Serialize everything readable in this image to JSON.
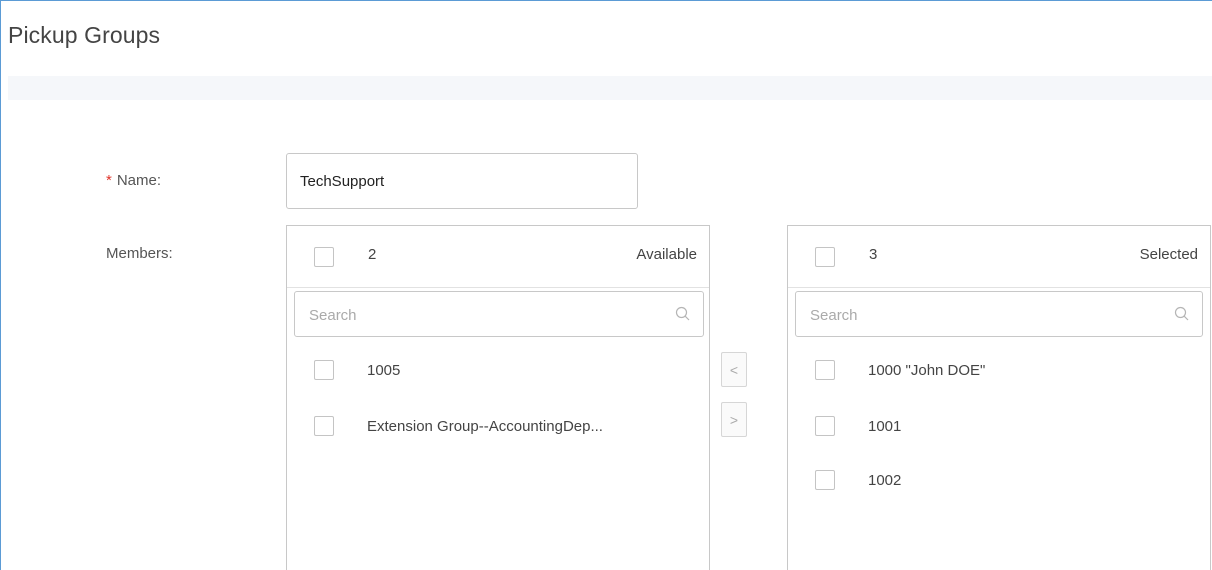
{
  "page": {
    "title": "Pickup Groups"
  },
  "form": {
    "name_required_mark": "*",
    "name_label": "Name:",
    "name_value": "TechSupport",
    "members_label": "Members:"
  },
  "available": {
    "count": "2",
    "title": "Available",
    "search_placeholder": "Search",
    "items": [
      "1005",
      "Extension Group--AccountingDep..."
    ]
  },
  "selected": {
    "count": "3",
    "title": "Selected",
    "search_placeholder": "Search",
    "items": [
      "1000 \"John DOE\"",
      "1001",
      "1002"
    ]
  },
  "transfer": {
    "move_left_label": "<",
    "move_right_label": ">"
  },
  "icons": {
    "search": "search-icon",
    "checkbox": "checkbox"
  },
  "colors": {
    "required": "#e0352b",
    "frame_border": "#5b9bd5"
  }
}
